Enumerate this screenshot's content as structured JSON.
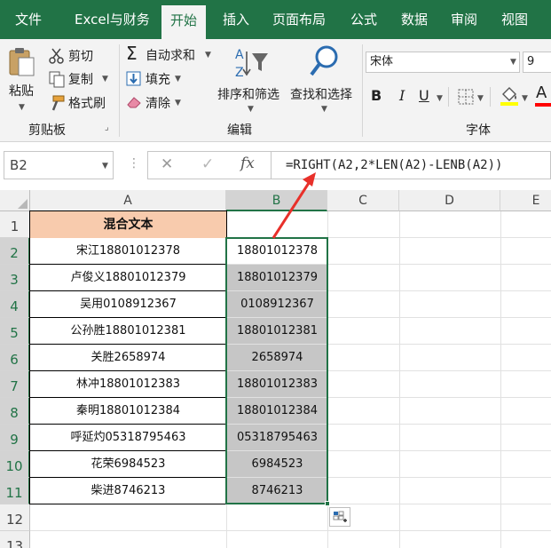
{
  "tabs": [
    {
      "label": "文件"
    },
    {
      "label": "Excel与财务"
    },
    {
      "label": "开始"
    },
    {
      "label": "插入"
    },
    {
      "label": "页面布局"
    },
    {
      "label": "公式"
    },
    {
      "label": "数据"
    },
    {
      "label": "审阅"
    },
    {
      "label": "视图"
    }
  ],
  "ribbon": {
    "clipboard": {
      "paste_label": "粘贴",
      "cut_label": "剪切",
      "copy_label": "复制",
      "format_painter_label": "格式刷",
      "group_label": "剪贴板"
    },
    "editing": {
      "autosum_label": "自动求和",
      "fill_label": "填充",
      "clear_label": "清除",
      "sort_filter_label": "排序和筛选",
      "find_select_label": "查找和选择",
      "group_label": "编辑"
    },
    "font": {
      "font_name": "宋体",
      "font_size": "9",
      "bold_label": "B",
      "italic_label": "I",
      "underline_label": "U",
      "font_color_label": "A",
      "group_label": "字体"
    }
  },
  "formula_bar": {
    "name_box": "B2",
    "cancel_symbol": "✕",
    "enter_symbol": "✓",
    "fx_label": "fx",
    "formula": "=RIGHT(A2,2*LEN(A2)-LENB(A2))"
  },
  "sheet": {
    "columns": [
      "A",
      "B",
      "C",
      "D",
      "E"
    ],
    "rows": [
      "1",
      "2",
      "3",
      "4",
      "5",
      "6",
      "7",
      "8",
      "9",
      "10",
      "11",
      "12",
      "13"
    ],
    "header_cell": "混合文本",
    "data": [
      {
        "a": "宋江18801012378",
        "b": "18801012378"
      },
      {
        "a": "卢俊义18801012379",
        "b": "18801012379"
      },
      {
        "a": "吴用0108912367",
        "b": "0108912367"
      },
      {
        "a": "公孙胜18801012381",
        "b": "18801012381"
      },
      {
        "a": "关胜2658974",
        "b": "2658974"
      },
      {
        "a": "林冲18801012383",
        "b": "18801012383"
      },
      {
        "a": "秦明18801012384",
        "b": "18801012384"
      },
      {
        "a": "呼延灼05318795463",
        "b": "05318795463"
      },
      {
        "a": "花荣6984523",
        "b": "6984523"
      },
      {
        "a": "柴进8746213",
        "b": "8746213"
      }
    ]
  },
  "colors": {
    "brand_green": "#217346",
    "header_fill": "#f8cbad",
    "selection_fill": "#c6c6c6",
    "arrow_red": "#e8302a"
  }
}
